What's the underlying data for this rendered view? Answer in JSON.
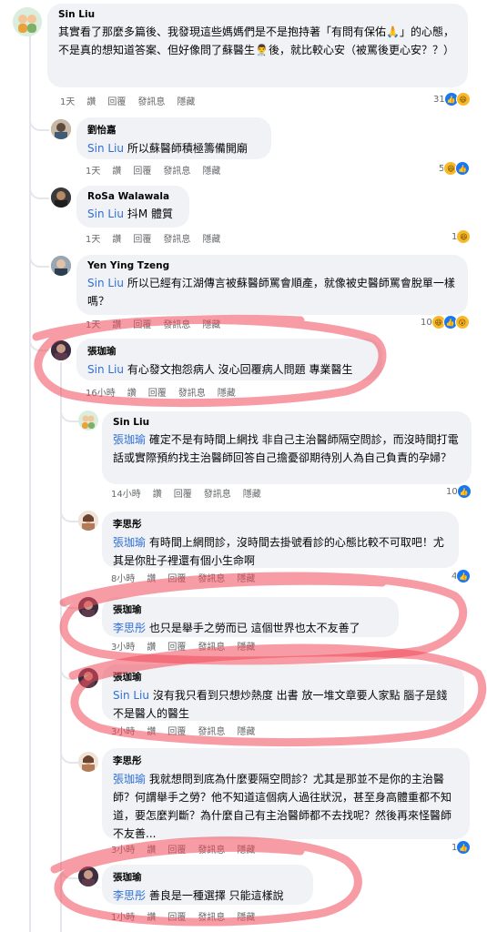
{
  "actions": {
    "like": "讚",
    "reply": "回覆",
    "message": "發訊息",
    "hide": "隱藏"
  },
  "comments": [
    {
      "name": "Sin Liu",
      "mention": "",
      "text": "其實看了那麼多篇後、我發現這些媽媽們是不是抱持著「有問有保佑🙏」的心態，不是真的想知道答案、但好像問了蘇醫生👨‍⚕️後，就比較心安（被罵後更心安？？）",
      "time": "1天",
      "reactions": "31",
      "react_icons": [
        "like-icon",
        "haha-icon"
      ]
    },
    {
      "name": "劉怡嘉",
      "mention": "Sin Liu",
      "text": "所以蘇醫師積極籌備開廟",
      "time": "1天",
      "reactions": "5",
      "react_icons": [
        "haha-icon",
        "like-icon"
      ]
    },
    {
      "name": "RoSa Walawala",
      "mention": "Sin Liu",
      "text": "抖M 體質",
      "time": "1天",
      "reactions": "1",
      "react_icons": [
        "haha-icon"
      ]
    },
    {
      "name": "Yen Ying Tzeng",
      "mention": "Sin Liu",
      "text": "所以已經有江湖傳言被蘇醫師罵會順產，就像被史醫師罵會脫單一樣嗎？",
      "time": "1天",
      "reactions": "10",
      "react_icons": [
        "haha-icon",
        "like-icon",
        "wow-icon"
      ]
    },
    {
      "name": "張珈瑜",
      "mention": "Sin Liu",
      "text": "有心發文抱怨病人 沒心回覆病人問題 專業醫生",
      "time": "16小時",
      "reactions": "",
      "react_icons": []
    },
    {
      "name": "Sin Liu",
      "mention": "張珈瑜",
      "text": "確定不是有時間上網找 非自己主治醫師隔空問診，而沒時間打電話或實際預約找主治醫師回答自己擔憂卻期待別人為自己負責的孕婦？",
      "time": "14小時",
      "reactions": "10",
      "react_icons": [
        "like-icon"
      ]
    },
    {
      "name": "李思彤",
      "mention": "張珈瑜",
      "text": "有時間上網問診，沒時間去掛號看診的心態比較不可取吧！尤其是你肚子裡還有個小生命啊",
      "time": "8小時",
      "reactions": "4",
      "react_icons": [
        "like-icon"
      ]
    },
    {
      "name": "張珈瑜",
      "mention": "李思彤",
      "text": "也只是舉手之勞而已 這個世界也太不友善了",
      "time": "3小時",
      "reactions": "",
      "react_icons": []
    },
    {
      "name": "張珈瑜",
      "mention": "Sin Liu",
      "text": "沒有我只看到只想炒熱度 出書 放一堆文章要人家點 腦子是錢不是醫人的醫生",
      "time": "3小時",
      "reactions": "",
      "react_icons": []
    },
    {
      "name": "李思彤",
      "mention": "張珈瑜",
      "text": "我就想問到底為什麼要隔空問診？尤其是那並不是你的主治醫師？何謂舉手之勞？他不知道這個病人過往狀況，甚至身高體重都不知道，要怎麼判斷？為什麼自己有主治醫師都不去找呢？然後再來怪醫師不友善...",
      "time": "3小時",
      "reactions": "1",
      "react_icons": [
        "like-icon"
      ]
    },
    {
      "name": "張珈瑜",
      "mention": "李思彤",
      "text": "善良是一種選擇 只能這樣說",
      "time": "1小時",
      "reactions": "",
      "react_icons": []
    }
  ],
  "colors": {
    "mention": "#2f6fd6",
    "bubble": "#f0f2f5",
    "annotation": "#f04a5a"
  }
}
